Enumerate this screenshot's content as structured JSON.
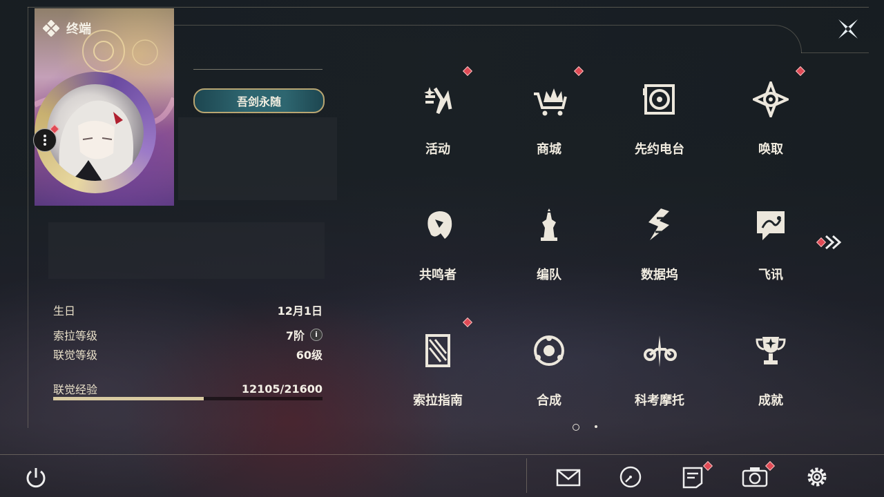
{
  "panel": {
    "title": "终端"
  },
  "profile": {
    "title_badge": "吾剑永随",
    "stats": [
      {
        "key": "生日",
        "value": "12月1日"
      },
      {
        "key": "索拉等级",
        "value": "7阶"
      },
      {
        "key": "联觉等级",
        "value": "60级"
      },
      {
        "key": "联觉经验",
        "value": "12105/21600"
      }
    ],
    "exp_progress": 0.56
  },
  "menu": [
    {
      "label": "活动",
      "icon": "activity-icon",
      "badge": true
    },
    {
      "label": "商城",
      "icon": "shop-icon",
      "badge": true
    },
    {
      "label": "先约电台",
      "icon": "radio-icon",
      "badge": false
    },
    {
      "label": "唤取",
      "icon": "convene-icon",
      "badge": true
    },
    {
      "label": "共鸣者",
      "icon": "resonator-icon",
      "badge": false
    },
    {
      "label": "编队",
      "icon": "team-icon",
      "badge": false
    },
    {
      "label": "数据坞",
      "icon": "data-bank-icon",
      "badge": false
    },
    {
      "label": "飞讯",
      "icon": "chat-icon",
      "badge": false
    },
    {
      "label": "索拉指南",
      "icon": "guidebook-icon",
      "badge": true
    },
    {
      "label": "合成",
      "icon": "synthesis-icon",
      "badge": false
    },
    {
      "label": "科考摩托",
      "icon": "motorcycle-icon",
      "badge": false
    },
    {
      "label": "成就",
      "icon": "trophy-icon",
      "badge": false
    }
  ],
  "pager": {
    "current": 1,
    "total": 2
  },
  "colors": {
    "accent_gold": "#d9cba2",
    "badge_red": "#e04a55",
    "text": "#ece7dc"
  }
}
